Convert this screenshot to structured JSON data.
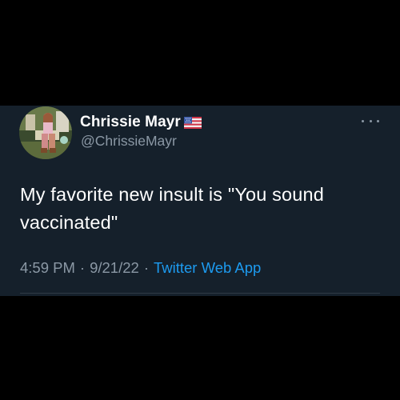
{
  "user": {
    "display_name": "Chrissie Mayr",
    "handle": "@ChrissieMayr",
    "flag_icon": "us-flag-icon"
  },
  "tweet": {
    "text": "My favorite new insult is \"You sound vaccinated\"",
    "time": "4:59 PM",
    "separator_1": "·",
    "date": "9/21/22",
    "separator_2": "·",
    "source": "Twitter Web App"
  },
  "colors": {
    "background": "#000000",
    "card_background": "#15202b",
    "primary_text": "#ffffff",
    "secondary_text": "#8b98a5",
    "link": "#1d9bf0"
  },
  "icons": {
    "more": "more-dots-icon"
  }
}
